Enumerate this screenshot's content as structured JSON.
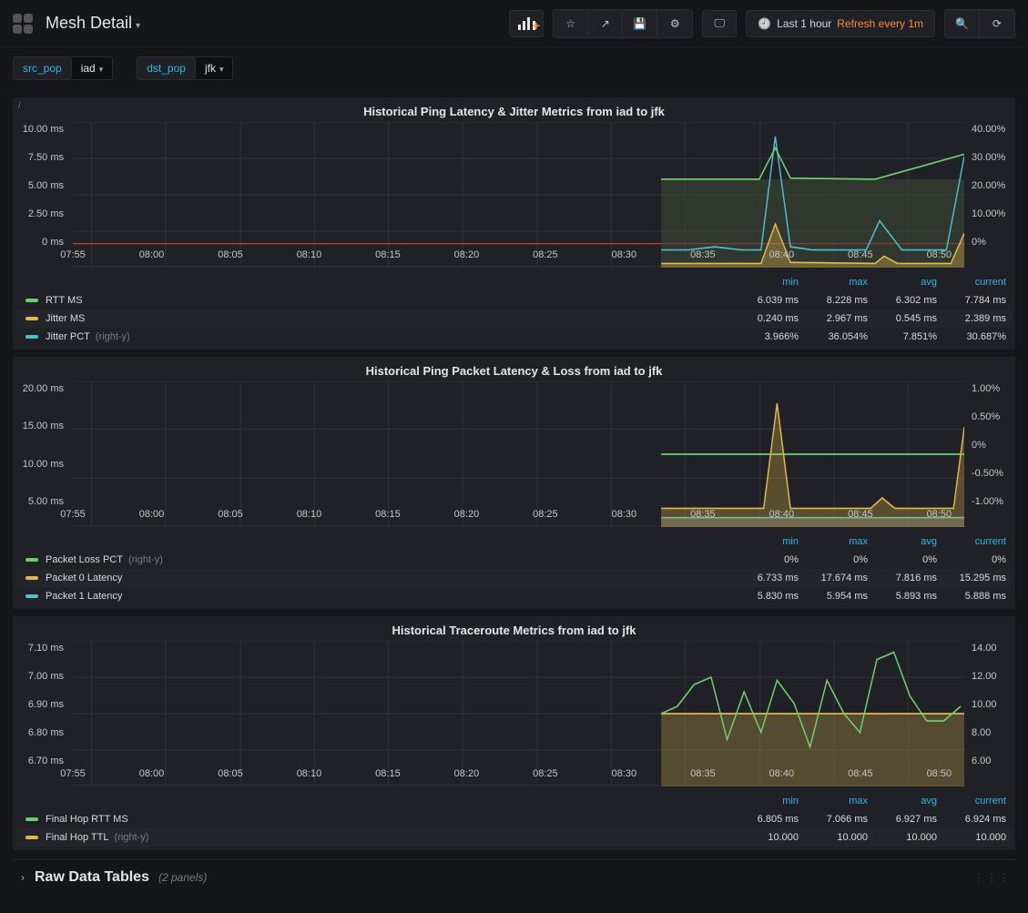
{
  "header": {
    "title": "Mesh Detail",
    "time_label": "Last 1 hour",
    "refresh_label": "Refresh every 1m"
  },
  "vars": {
    "src_label": "src_pop",
    "src_value": "iad",
    "dst_label": "dst_pop",
    "dst_value": "jfk"
  },
  "xticks": [
    "07:55",
    "08:00",
    "08:05",
    "08:10",
    "08:15",
    "08:20",
    "08:25",
    "08:30",
    "08:35",
    "08:40",
    "08:45",
    "08:50"
  ],
  "legend_cols": {
    "c0": "min",
    "c1": "max",
    "c2": "avg",
    "c3": "current"
  },
  "panel1": {
    "title": "Historical Ping Latency & Jitter Metrics from iad to jfk",
    "yl": [
      "10.00 ms",
      "7.50 ms",
      "5.00 ms",
      "2.50 ms",
      "0 ms"
    ],
    "yr": [
      "40.00%",
      "30.00%",
      "20.00%",
      "10.00%",
      "0%"
    ],
    "rows": [
      {
        "name": "RTT MS",
        "color": "#6fcf6f",
        "min": "6.039 ms",
        "max": "8.228 ms",
        "avg": "6.302 ms",
        "cur": "7.784 ms"
      },
      {
        "name": "Jitter MS",
        "color": "#e0b94a",
        "min": "0.240 ms",
        "max": "2.967 ms",
        "avg": "0.545 ms",
        "cur": "2.389 ms"
      },
      {
        "name": "Jitter PCT",
        "color": "#4fbfca",
        "axis": "(right-y)",
        "min": "3.966%",
        "max": "36.054%",
        "avg": "7.851%",
        "cur": "30.687%"
      }
    ]
  },
  "panel2": {
    "title": "Historical Ping Packet Latency & Loss from iad to jfk",
    "yl": [
      "20.00 ms",
      "15.00 ms",
      "10.00 ms",
      "5.00 ms"
    ],
    "yr": [
      "1.00%",
      "0.50%",
      "0%",
      "-0.50%",
      "-1.00%"
    ],
    "rows": [
      {
        "name": "Packet Loss PCT",
        "color": "#6fcf6f",
        "axis": "(right-y)",
        "min": "0%",
        "max": "0%",
        "avg": "0%",
        "cur": "0%"
      },
      {
        "name": "Packet 0 Latency",
        "color": "#e0b94a",
        "min": "6.733 ms",
        "max": "17.674 ms",
        "avg": "7.816 ms",
        "cur": "15.295 ms"
      },
      {
        "name": "Packet 1 Latency",
        "color": "#4fbfca",
        "min": "5.830 ms",
        "max": "5.954 ms",
        "avg": "5.893 ms",
        "cur": "5.888 ms"
      }
    ]
  },
  "panel3": {
    "title": "Historical Traceroute Metrics from iad to jfk",
    "yl": [
      "7.10 ms",
      "7.00 ms",
      "6.90 ms",
      "6.80 ms",
      "6.70 ms"
    ],
    "yr": [
      "14.00",
      "12.00",
      "10.00",
      "8.00",
      "6.00"
    ],
    "rows": [
      {
        "name": "Final Hop RTT MS",
        "color": "#6fcf6f",
        "min": "6.805 ms",
        "max": "7.066 ms",
        "avg": "6.927 ms",
        "cur": "6.924 ms"
      },
      {
        "name": "Final Hop TTL",
        "color": "#e0b94a",
        "axis": "(right-y)",
        "min": "10.000",
        "max": "10.000",
        "avg": "10.000",
        "cur": "10.000"
      }
    ]
  },
  "row": {
    "title": "Raw Data Tables",
    "count": "(2 panels)"
  },
  "chart_data": [
    {
      "title": "Historical Ping Latency & Jitter Metrics from iad to jfk",
      "type": "line",
      "x": [
        "08:33",
        "08:34",
        "08:35",
        "08:36",
        "08:37",
        "08:38",
        "08:39",
        "08:40",
        "08:41",
        "08:42",
        "08:43",
        "08:44",
        "08:45",
        "08:46",
        "08:47",
        "08:48",
        "08:49",
        "08:50",
        "08:51",
        "08:52"
      ],
      "y_left": {
        "label": "ms",
        "range": [
          0,
          10
        ]
      },
      "y_right": {
        "label": "%",
        "range": [
          0,
          40
        ]
      },
      "series": [
        {
          "name": "RTT MS",
          "axis": "left",
          "values": [
            6.1,
            6.1,
            6.1,
            6.1,
            6.1,
            6.1,
            6.1,
            6.1,
            8.2,
            6.2,
            6.2,
            6.1,
            6.1,
            6.1,
            6.2,
            6.1,
            6.1,
            6.2,
            6.2,
            7.8
          ]
        },
        {
          "name": "Jitter MS",
          "axis": "left",
          "values": [
            0.3,
            0.3,
            0.4,
            0.3,
            0.3,
            0.3,
            0.4,
            0.4,
            3.0,
            0.4,
            0.3,
            0.3,
            0.3,
            0.3,
            0.3,
            0.8,
            0.3,
            0.3,
            0.3,
            2.4
          ]
        },
        {
          "name": "Jitter PCT",
          "axis": "right",
          "values": [
            5,
            5,
            6,
            5,
            5,
            5,
            6,
            6,
            36,
            6,
            5,
            5,
            5,
            5,
            5,
            13,
            5,
            5,
            5,
            31
          ]
        }
      ],
      "note": "horizontal red reference line at ~1.6 ms on left axis"
    },
    {
      "title": "Historical Ping Packet Latency & Loss from iad to jfk",
      "type": "line",
      "x": [
        "08:33",
        "08:34",
        "08:35",
        "08:36",
        "08:37",
        "08:38",
        "08:39",
        "08:40",
        "08:41",
        "08:42",
        "08:43",
        "08:44",
        "08:45",
        "08:46",
        "08:47",
        "08:48",
        "08:49",
        "08:50",
        "08:51",
        "08:52"
      ],
      "y_left": {
        "label": "ms",
        "range": [
          5,
          20
        ]
      },
      "y_right": {
        "label": "%",
        "range": [
          -1,
          1
        ]
      },
      "series": [
        {
          "name": "Packet Loss PCT",
          "axis": "right",
          "values": [
            0,
            0,
            0,
            0,
            0,
            0,
            0,
            0,
            0,
            0,
            0,
            0,
            0,
            0,
            0,
            0,
            0,
            0,
            0,
            0
          ]
        },
        {
          "name": "Packet 0 Latency",
          "axis": "left",
          "values": [
            6.9,
            6.9,
            6.9,
            6.9,
            6.9,
            6.9,
            6.9,
            7.0,
            17.7,
            7.0,
            6.9,
            6.9,
            6.9,
            6.9,
            6.9,
            8.0,
            6.9,
            6.9,
            6.9,
            15.3
          ]
        },
        {
          "name": "Packet 1 Latency",
          "axis": "left",
          "values": [
            5.9,
            5.9,
            5.9,
            5.9,
            5.9,
            5.9,
            5.9,
            5.9,
            5.9,
            5.9,
            5.9,
            5.9,
            5.9,
            5.9,
            5.9,
            5.9,
            5.9,
            5.9,
            5.9,
            5.9
          ]
        }
      ]
    },
    {
      "title": "Historical Traceroute Metrics from iad to jfk",
      "type": "line",
      "x": [
        "08:33",
        "08:34",
        "08:35",
        "08:36",
        "08:37",
        "08:38",
        "08:39",
        "08:40",
        "08:41",
        "08:42",
        "08:43",
        "08:44",
        "08:45",
        "08:46",
        "08:47",
        "08:48",
        "08:49",
        "08:50",
        "08:51"
      ],
      "y_left": {
        "label": "ms",
        "range": [
          6.7,
          7.1
        ]
      },
      "y_right": {
        "label": "",
        "range": [
          6,
          14
        ]
      },
      "series": [
        {
          "name": "Final Hop RTT MS",
          "axis": "left",
          "values": [
            6.9,
            6.92,
            6.98,
            7.0,
            6.83,
            6.96,
            6.85,
            6.99,
            6.93,
            6.81,
            6.99,
            6.9,
            6.85,
            7.05,
            7.07,
            6.95,
            6.88,
            6.88,
            6.92
          ]
        },
        {
          "name": "Final Hop TTL",
          "axis": "right",
          "values": [
            10,
            10,
            10,
            10,
            10,
            10,
            10,
            10,
            10,
            10,
            10,
            10,
            10,
            10,
            10,
            10,
            10,
            10,
            10
          ]
        }
      ]
    }
  ]
}
